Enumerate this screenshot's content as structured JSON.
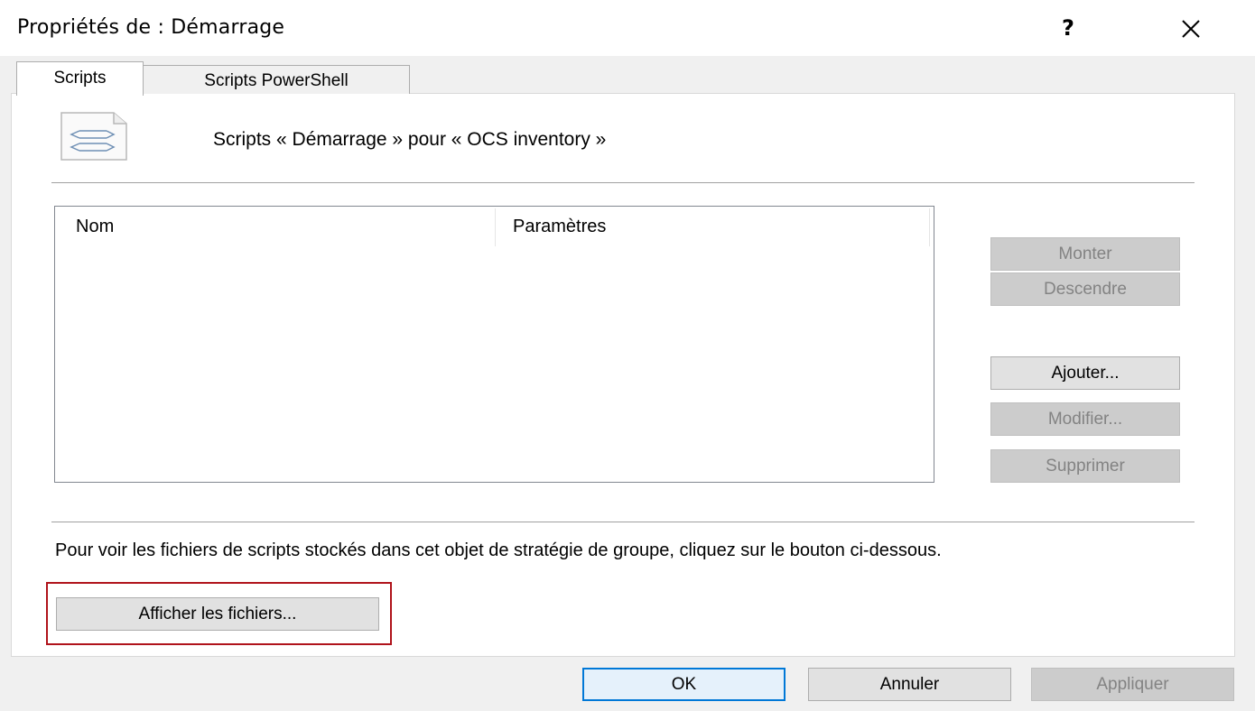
{
  "window": {
    "title": "Propriétés de : Démarrage",
    "help_label": "?",
    "close_icon": "close-icon"
  },
  "tabs": [
    {
      "label": "Scripts",
      "selected": true
    },
    {
      "label": "Scripts PowerShell",
      "selected": false
    }
  ],
  "scripts_tab": {
    "icon": "script-file-icon",
    "heading": "Scripts « Démarrage » pour « OCS inventory »",
    "list": {
      "columns": [
        "Nom",
        "Paramètres"
      ],
      "rows": []
    },
    "buttons": {
      "up": {
        "label": "Monter",
        "enabled": false
      },
      "down": {
        "label": "Descendre",
        "enabled": false
      },
      "add": {
        "label": "Ajouter...",
        "enabled": true
      },
      "edit": {
        "label": "Modifier...",
        "enabled": false
      },
      "remove": {
        "label": "Supprimer",
        "enabled": false
      }
    },
    "info_text": "Pour voir les fichiers de scripts stockés dans cet objet de stratégie de groupe, cliquez sur le bouton ci-dessous.",
    "show_files_label": "Afficher les fichiers...",
    "highlight_color": "#b0131b"
  },
  "footer": {
    "ok_label": "OK",
    "cancel_label": "Annuler",
    "apply_label": "Appliquer",
    "apply_enabled": false
  },
  "colors": {
    "focus_border": "#0078d7",
    "disabled_text": "#838383"
  }
}
